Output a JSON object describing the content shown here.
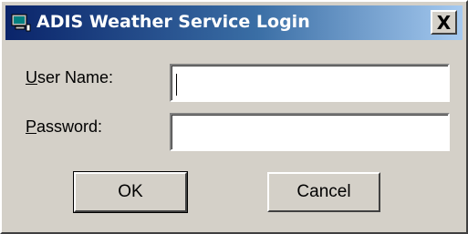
{
  "window": {
    "title": "ADIS Weather Service Login",
    "app_icon": "computer-icon",
    "close_label": "X"
  },
  "form": {
    "username_label_accel": "U",
    "username_label_rest": "ser Name:",
    "username_value": "",
    "password_label_accel": "P",
    "password_label_rest": "assword:",
    "password_value": ""
  },
  "buttons": {
    "ok_label": "OK",
    "cancel_label": "Cancel"
  },
  "colors": {
    "titlebar_start": "#0a246a",
    "titlebar_end": "#a6caf0",
    "face": "#d4d0c8"
  }
}
